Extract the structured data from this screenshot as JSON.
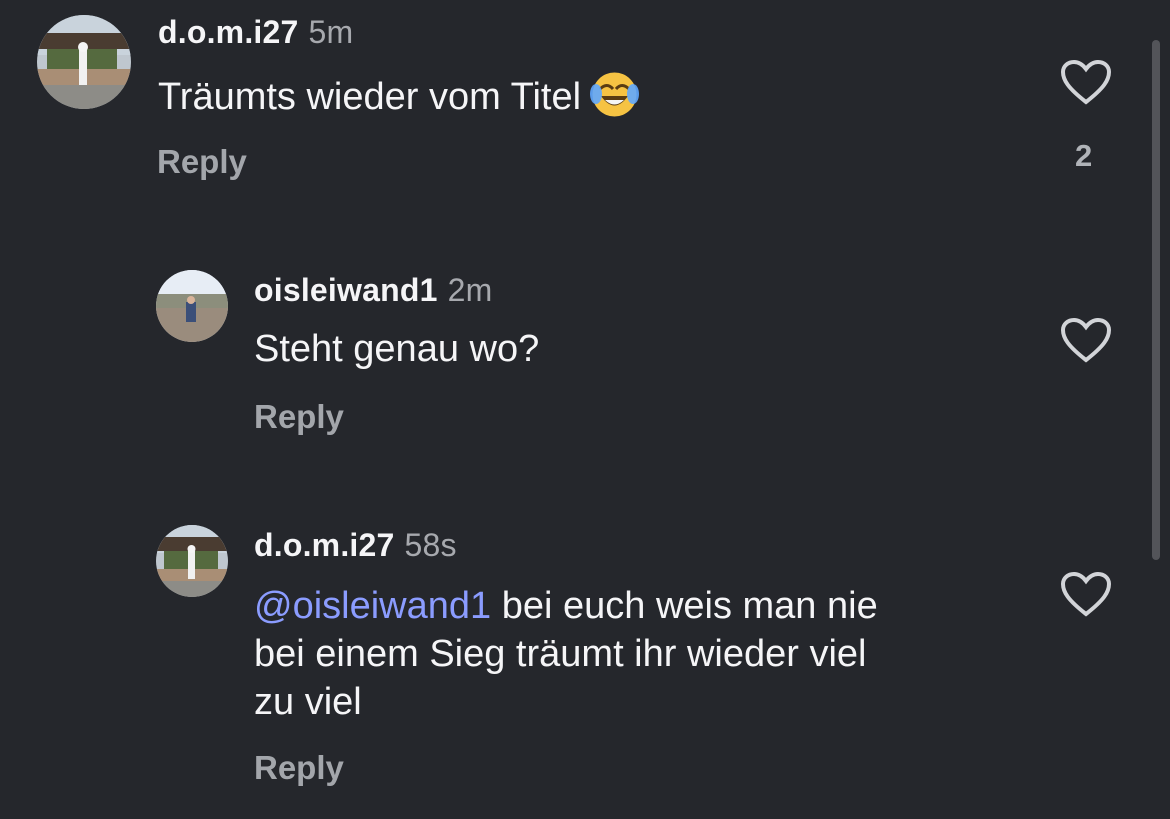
{
  "comments": [
    {
      "username": "d.o.m.i27",
      "time": "5m",
      "text": "Träumts wieder vom Titel",
      "emoji": "laughing-crying-emoji",
      "reply_label": "Reply",
      "likes": "2"
    },
    {
      "username": "oisleiwand1",
      "time": "2m",
      "text": "Steht genau wo?",
      "reply_label": "Reply"
    },
    {
      "username": "d.o.m.i27",
      "time": "58s",
      "mention": "@oisleiwand1",
      "text_line1": " bei euch weis man nie",
      "text_line2": "bei einem Sieg träumt ihr wieder viel",
      "text_line3": "zu viel",
      "reply_label": "Reply"
    }
  ],
  "icons": {
    "like": "heart-outline-icon",
    "avatar": "avatar-photo"
  },
  "colors": {
    "background": "#25272c",
    "mention": "#8b9cff",
    "secondary_text": "#a3a6ab"
  }
}
